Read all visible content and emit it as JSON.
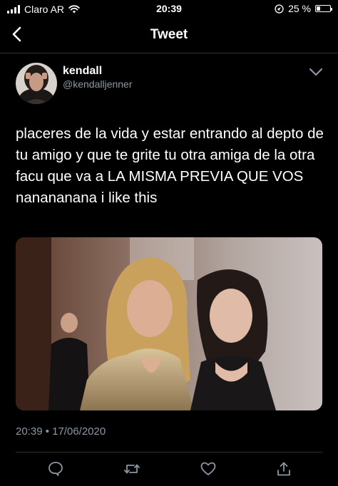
{
  "status_bar": {
    "carrier": "Claro AR",
    "time": "20:39",
    "battery": "25 %",
    "battery_level": 0.25
  },
  "nav": {
    "title": "Tweet"
  },
  "tweet": {
    "author_name": "kendall",
    "author_handle": "@kendalljenner",
    "text": "placeres de la vida y estar entrando al depto de tu amigo y que te grite tu otra amiga de la otra facu que va a LA MISMA PREVIA QUE VOS nanananana i like this",
    "timestamp": "20:39 • 17/06/2020"
  },
  "icons": {
    "back": "chevron-left-icon",
    "more": "chevron-down-icon",
    "reply": "comment-icon",
    "retweet": "retweet-icon",
    "like": "heart-icon",
    "share": "share-icon",
    "wifi": "wifi-icon",
    "location": "location-arrow-icon"
  },
  "colors": {
    "background": "#000000",
    "text": "#ffffff",
    "secondary_text": "#8b98a5",
    "divider": "#2f3336"
  }
}
